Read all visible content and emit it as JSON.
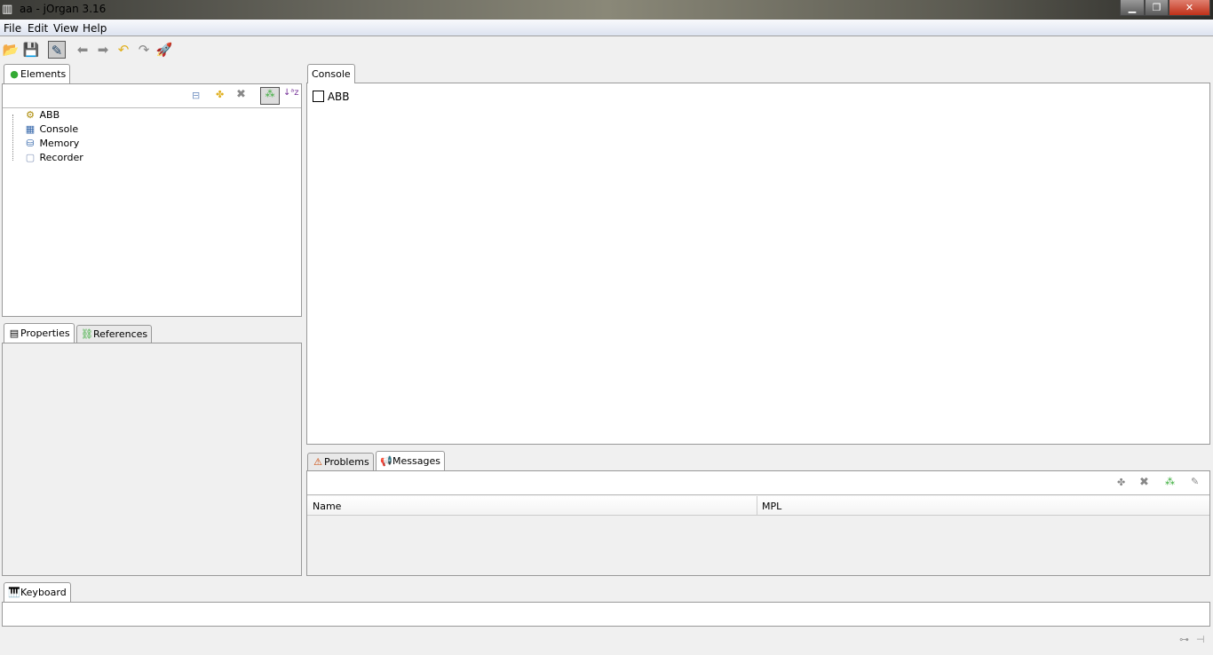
{
  "window": {
    "title": "aa - jOrgan 3.16",
    "min": "▁",
    "restore": "❐",
    "close": "✕"
  },
  "menu": [
    "File",
    "Edit",
    "View",
    "Help"
  ],
  "elements_panel": {
    "tab": "Elements",
    "items": [
      "ABB",
      "Console",
      "Memory",
      "Recorder"
    ]
  },
  "properties_panel": {
    "tabs": [
      "Properties",
      "References"
    ]
  },
  "console_panel": {
    "tab": "Console",
    "checkbox_label": "ABB"
  },
  "messages_panel": {
    "tabs": [
      "Problems",
      "Messages"
    ],
    "columns": [
      "Name",
      "MPL"
    ]
  },
  "keyboard_panel": {
    "tab": "Keyboard"
  }
}
